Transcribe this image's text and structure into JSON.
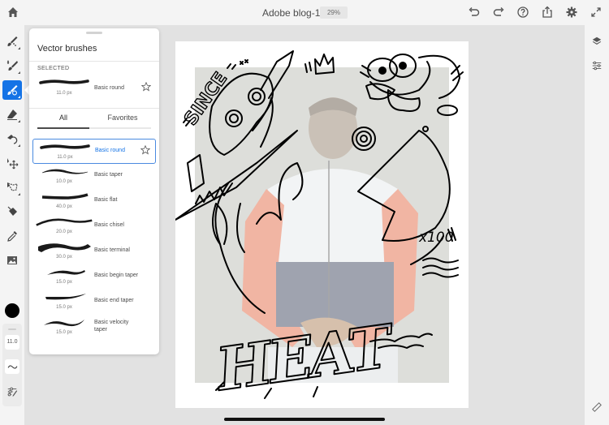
{
  "header": {
    "document_title": "Adobe blog-1-1",
    "zoom_level": "29%",
    "icons": [
      "home-icon",
      "undo-icon",
      "redo-icon",
      "help-icon",
      "share-icon",
      "settings-icon",
      "fullscreen-icon"
    ]
  },
  "left_toolbar": {
    "tools": [
      {
        "name": "pixel-brush",
        "icon": "pixel-brush-icon",
        "active": false
      },
      {
        "name": "live-brush",
        "icon": "live-brush-icon",
        "active": false
      },
      {
        "name": "vector-brush",
        "icon": "vector-brush-icon",
        "active": true
      },
      {
        "name": "eraser",
        "icon": "eraser-icon",
        "active": false
      },
      {
        "name": "smudge",
        "icon": "smudge-icon",
        "active": false
      },
      {
        "name": "transform",
        "icon": "move-icon",
        "active": false
      },
      {
        "name": "lasso",
        "icon": "lasso-icon",
        "active": false
      },
      {
        "name": "fill",
        "icon": "fill-bucket-icon",
        "active": false
      },
      {
        "name": "eyedropper",
        "icon": "eyedropper-icon",
        "active": false
      },
      {
        "name": "place-image",
        "icon": "image-icon",
        "active": false
      }
    ],
    "current_color": "#000000",
    "brush_size": "11.0"
  },
  "right_toolbar": {
    "icons": [
      "layers-icon",
      "layer-properties-icon",
      "touch-shortcut-icon"
    ]
  },
  "brush_panel": {
    "title": "Vector brushes",
    "selected_section_label": "SELECTED",
    "selected_brush": {
      "name": "Basic round",
      "size": "11.0 px"
    },
    "tabs": [
      {
        "label": "All",
        "active": true
      },
      {
        "label": "Favorites",
        "active": false
      }
    ],
    "brushes": [
      {
        "name": "Basic round",
        "size": "11.0 px",
        "selected": true
      },
      {
        "name": "Basic taper",
        "size": "10.0 px",
        "selected": false
      },
      {
        "name": "Basic flat",
        "size": "40.0 px",
        "selected": false
      },
      {
        "name": "Basic chisel",
        "size": "20.0 px",
        "selected": false
      },
      {
        "name": "Basic terminal",
        "size": "30.0 px",
        "selected": false
      },
      {
        "name": "Basic begin taper",
        "size": "15.0 px",
        "selected": false
      },
      {
        "name": "Basic end taper",
        "size": "15.0 px",
        "selected": false
      },
      {
        "name": "Basic velocity taper",
        "size": "15.0 px",
        "selected": false
      }
    ]
  },
  "canvas": {
    "artwork_text": [
      "SINCE",
      "HEAT",
      "x100"
    ]
  },
  "colors": {
    "accent": "#1473e6",
    "toolbar_bg": "#f4f4f4",
    "workspace_bg": "#e2e2e2"
  }
}
